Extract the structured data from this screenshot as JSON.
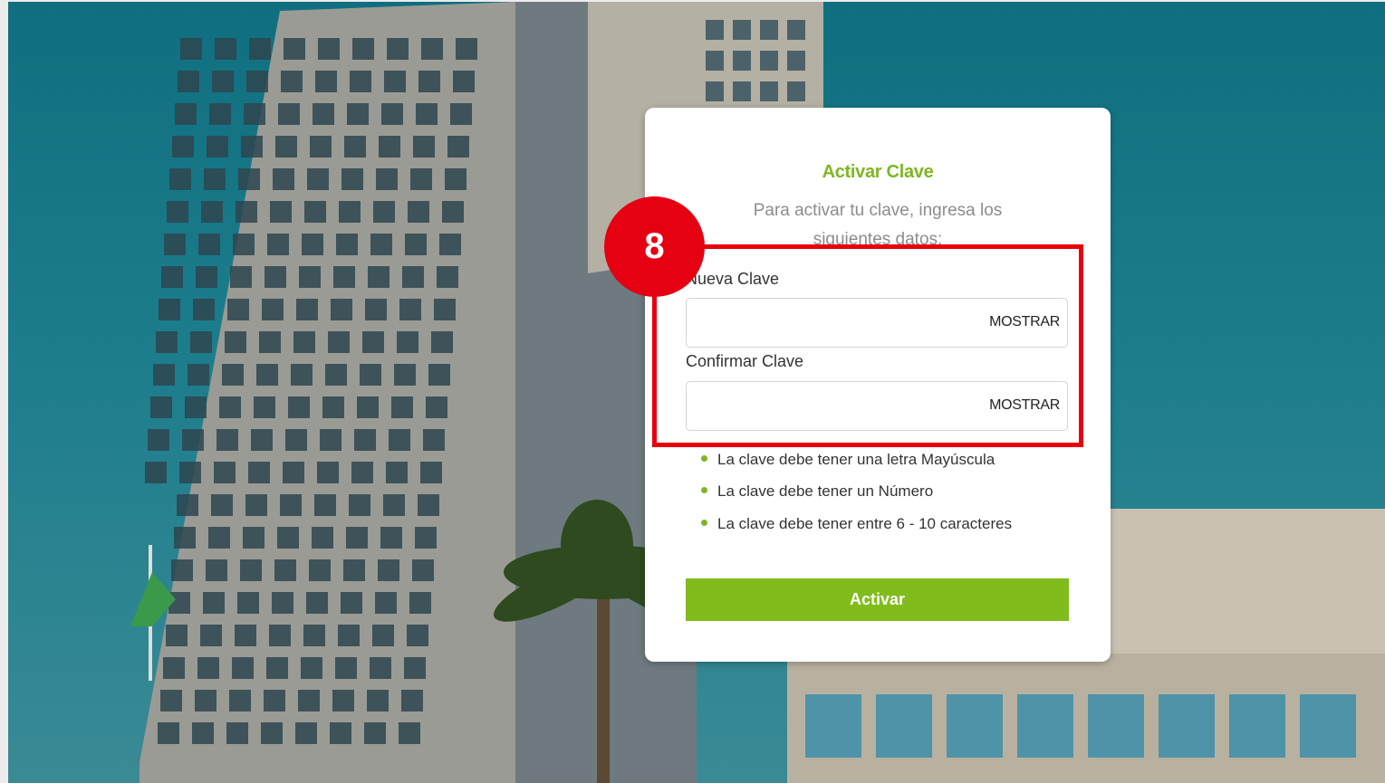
{
  "form": {
    "title": "Activar Clave",
    "subtitle": "Para activar tu clave, ingresa los siguientes datos:",
    "new_password_label": "Nueva Clave",
    "new_password_value": "",
    "confirm_password_label": "Confirmar Clave",
    "confirm_password_value": "",
    "show_label": "MOSTRAR",
    "rules": [
      "La clave debe tener una letra Mayúscula",
      "La clave debe tener un Número",
      "La clave debe tener entre 6 - 10 caracteres"
    ],
    "submit_label": "Activar"
  },
  "annotation": {
    "step_number": "8"
  },
  "colors": {
    "accent": "#80bc1c",
    "highlight": "#e8000e"
  }
}
